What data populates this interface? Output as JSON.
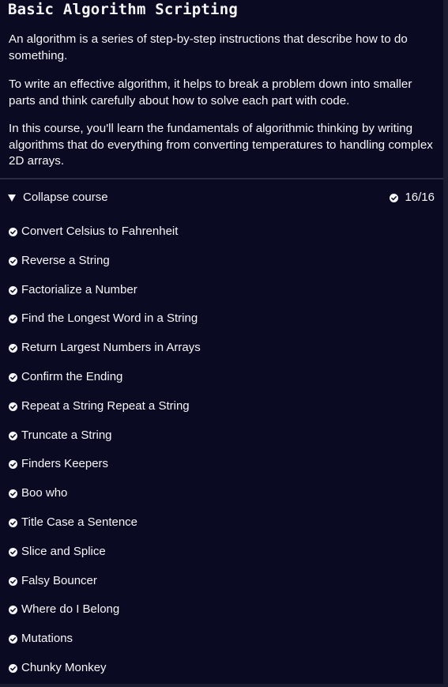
{
  "course": {
    "title": "Basic Algorithm Scripting",
    "intro": [
      "An algorithm is a series of step-by-step instructions that describe how to do something.",
      "To write an effective algorithm, it helps to break a problem down into smaller parts and think carefully about how to solve each part with code.",
      "In this course, you'll learn the fundamentals of algorithmic thinking by writing algorithms that do everything from converting temperatures to handling complex 2D arrays."
    ],
    "toggle_label": "Collapse course",
    "progress": "16/16"
  },
  "icons": {
    "collapse": "triangle-down-icon",
    "completed": "check-circle-icon"
  },
  "colors": {
    "background": "#0a0a23",
    "text": "#f5f6f7",
    "divider": "#2a2a40",
    "edge": "#1b1b32"
  },
  "challenges": [
    {
      "title": "Convert Celsius to Fahrenheit",
      "completed": true
    },
    {
      "title": "Reverse a String",
      "completed": true
    },
    {
      "title": "Factorialize a Number",
      "completed": true
    },
    {
      "title": "Find the Longest Word in a String",
      "completed": true
    },
    {
      "title": "Return Largest Numbers in Arrays",
      "completed": true
    },
    {
      "title": "Confirm the Ending",
      "completed": true
    },
    {
      "title": "Repeat a String Repeat a String",
      "completed": true
    },
    {
      "title": "Truncate a String",
      "completed": true
    },
    {
      "title": "Finders Keepers",
      "completed": true
    },
    {
      "title": "Boo who",
      "completed": true
    },
    {
      "title": "Title Case a Sentence",
      "completed": true
    },
    {
      "title": "Slice and Splice",
      "completed": true
    },
    {
      "title": "Falsy Bouncer",
      "completed": true
    },
    {
      "title": "Where do I Belong",
      "completed": true
    },
    {
      "title": "Mutations",
      "completed": true
    },
    {
      "title": "Chunky Monkey",
      "completed": true
    }
  ]
}
